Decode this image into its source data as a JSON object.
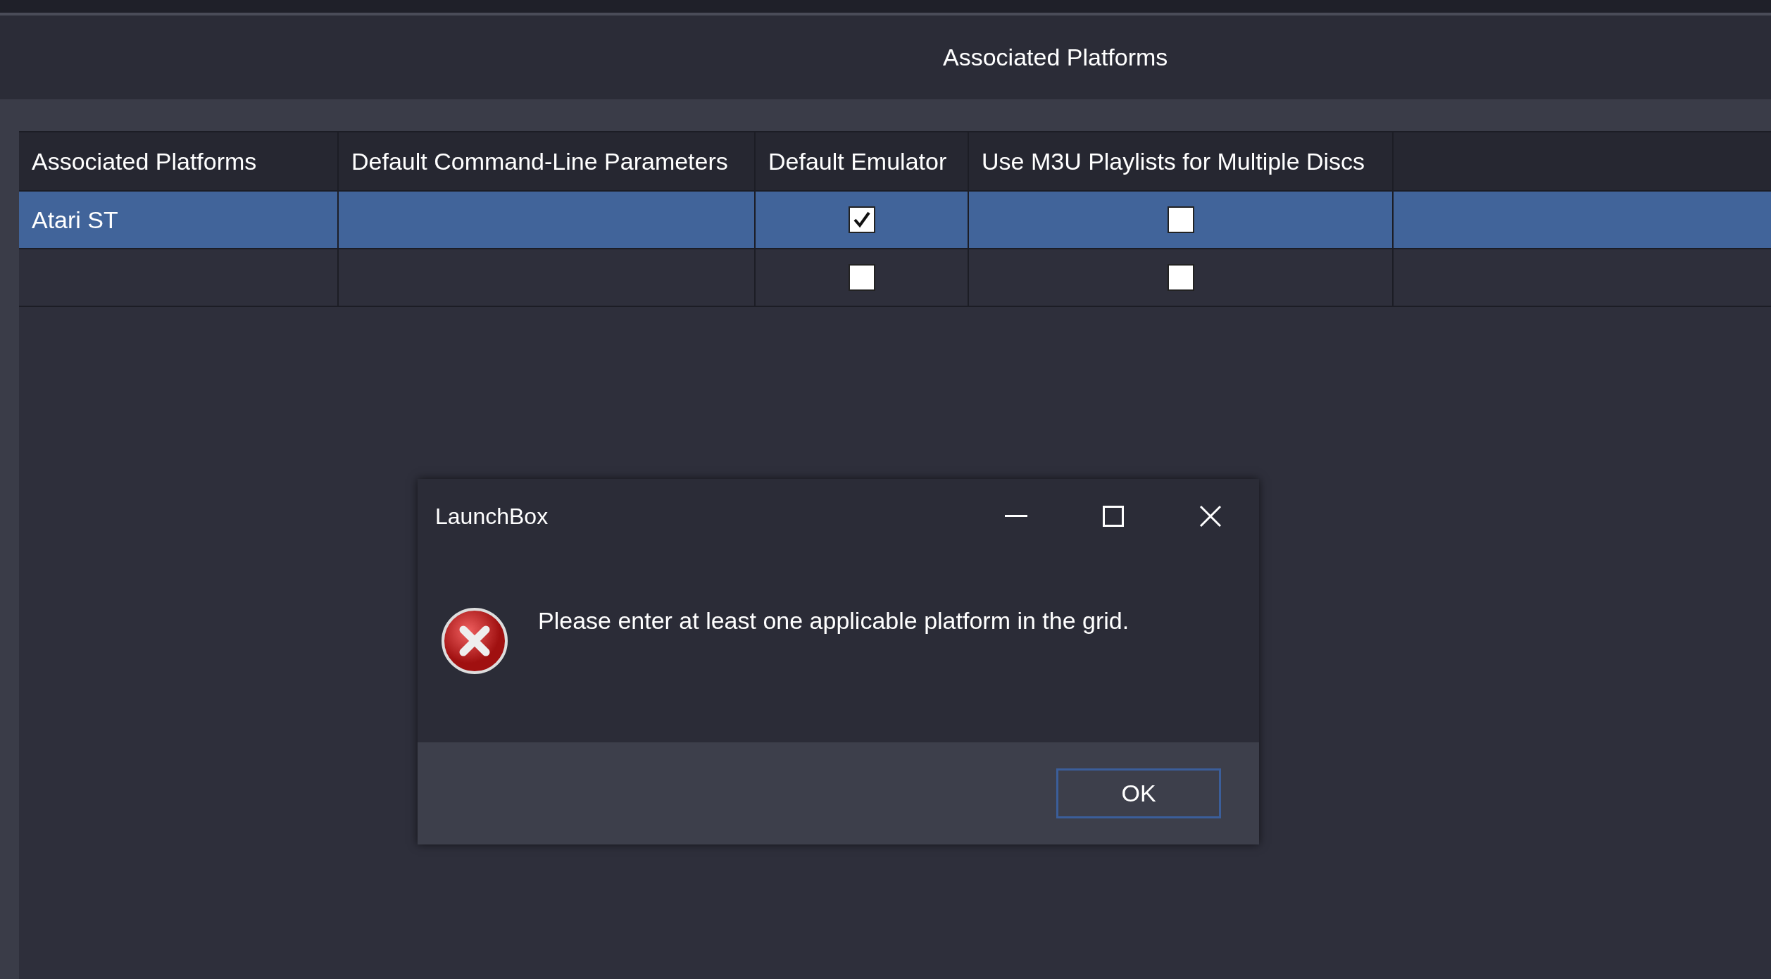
{
  "window": {
    "title": "Associated Platforms"
  },
  "grid": {
    "columns": [
      "Associated Platforms",
      "Default Command-Line Parameters",
      "Default Emulator",
      "Use M3U Playlists for Multiple Discs"
    ],
    "rows": [
      {
        "selected": true,
        "platform": "Atari ST",
        "default_emulator": true,
        "use_m3u": false
      },
      {
        "selected": false,
        "default_emulator": false,
        "use_m3u": false
      }
    ]
  },
  "dialog": {
    "title": "LaunchBox",
    "kind": "error",
    "message": "Please enter at least one applicable platform in the grid.",
    "button": "OK"
  }
}
